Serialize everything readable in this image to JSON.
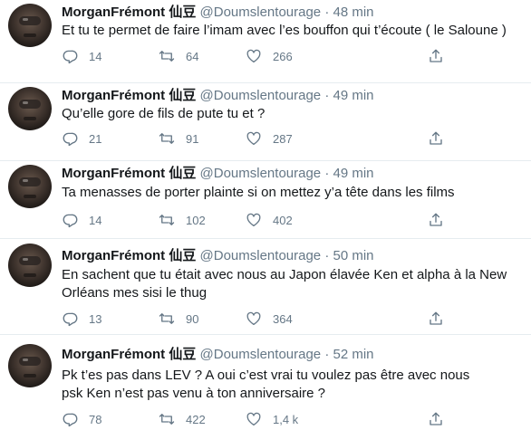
{
  "tweets": [
    {
      "name": "MorganFrémont 仙豆",
      "handle": "@Doumslentourage",
      "time": "48 min",
      "text": "Et tu te permet de faire l’imam avec l’es bouffon qui t’écoute ( le Saloune )",
      "replies": "14",
      "retweets": "64",
      "likes": "266"
    },
    {
      "name": "MorganFrémont 仙豆",
      "handle": "@Doumslentourage",
      "time": "49 min",
      "text": "Qu’elle gore de fils de pute tu et ?",
      "replies": "21",
      "retweets": "91",
      "likes": "287"
    },
    {
      "name": "MorganFrémont 仙豆",
      "handle": "@Doumslentourage",
      "time": "49 min",
      "text": "Ta menasses de porter plainte si on mettez y’a tête dans les films",
      "replies": "14",
      "retweets": "102",
      "likes": "402"
    },
    {
      "name": "MorganFrémont 仙豆",
      "handle": "@Doumslentourage",
      "time": "50 min",
      "text": "En sachent que tu était avec nous au Japon élavée Ken et alpha à la New Orléans mes sisi le thug",
      "replies": "13",
      "retweets": "90",
      "likes": "364"
    },
    {
      "name": "MorganFrémont 仙豆",
      "handle": "@Doumslentourage",
      "time": "52 min",
      "text": "Pk t’es pas dans LEV ? A oui c’est vrai tu voulez pas être avec nous psk Ken n’est pas venu à ton anniversaire ?",
      "replies": "78",
      "retweets": "422",
      "likes": "1,4 k"
    }
  ],
  "dot": "·",
  "icons": {
    "reply": "reply-icon",
    "retweet": "retweet-icon",
    "like": "heart-icon",
    "share": "share-icon",
    "menu": "chevron-down-icon"
  },
  "colors": {
    "text": "#14171a",
    "muted": "#657786",
    "divider": "#e6ecf0"
  }
}
